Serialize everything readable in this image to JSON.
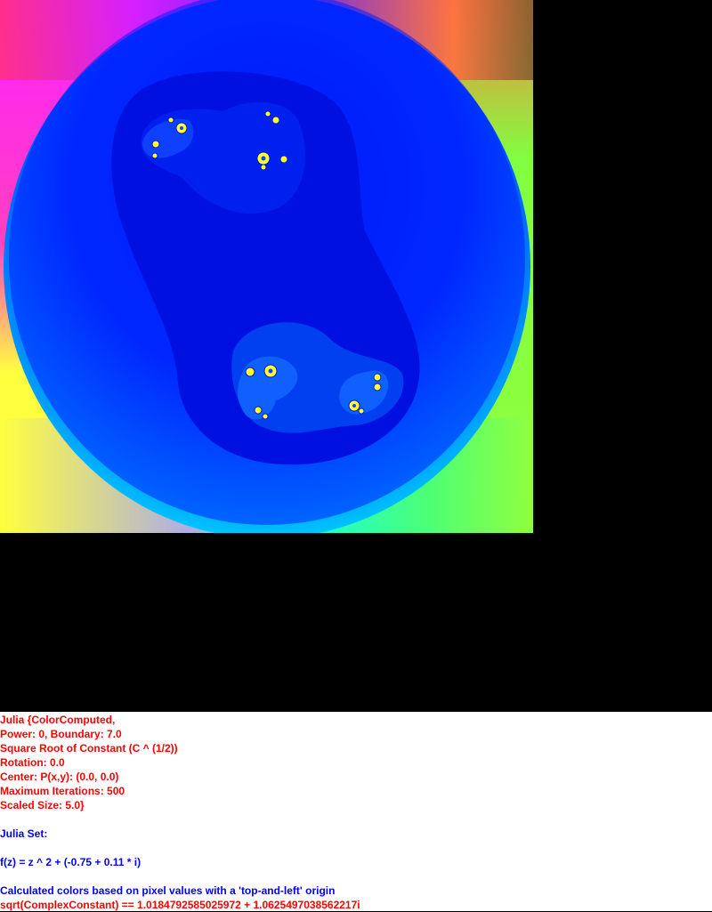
{
  "colors": {
    "settings_text": "#ff0000",
    "description_text": "#0000ff",
    "background": "#000000",
    "panel_background": "#ffffff"
  },
  "info": {
    "line1": "Julia {ColorComputed,",
    "line2": "Power: 0, Boundary: 7.0",
    "line3": "Square Root of Constant (C ^ (1/2))",
    "line4": "Rotation: 0.0",
    "line5": "Center: P(x,y): (0.0, 0.0)",
    "line6": "Maximum Iterations: 500",
    "line7": "Scaled Size: 5.0}",
    "set_label": "Julia Set:",
    "formula": "f(z) = z ^ 2 + (-0.75 + 0.11 * i)",
    "colors_note": "Calculated colors based on pixel values with a 'top-and-left' origin",
    "sqrt_result": "sqrt(ComplexConstant) == 1.0184792585025972 + 1.0625497038562217i"
  }
}
